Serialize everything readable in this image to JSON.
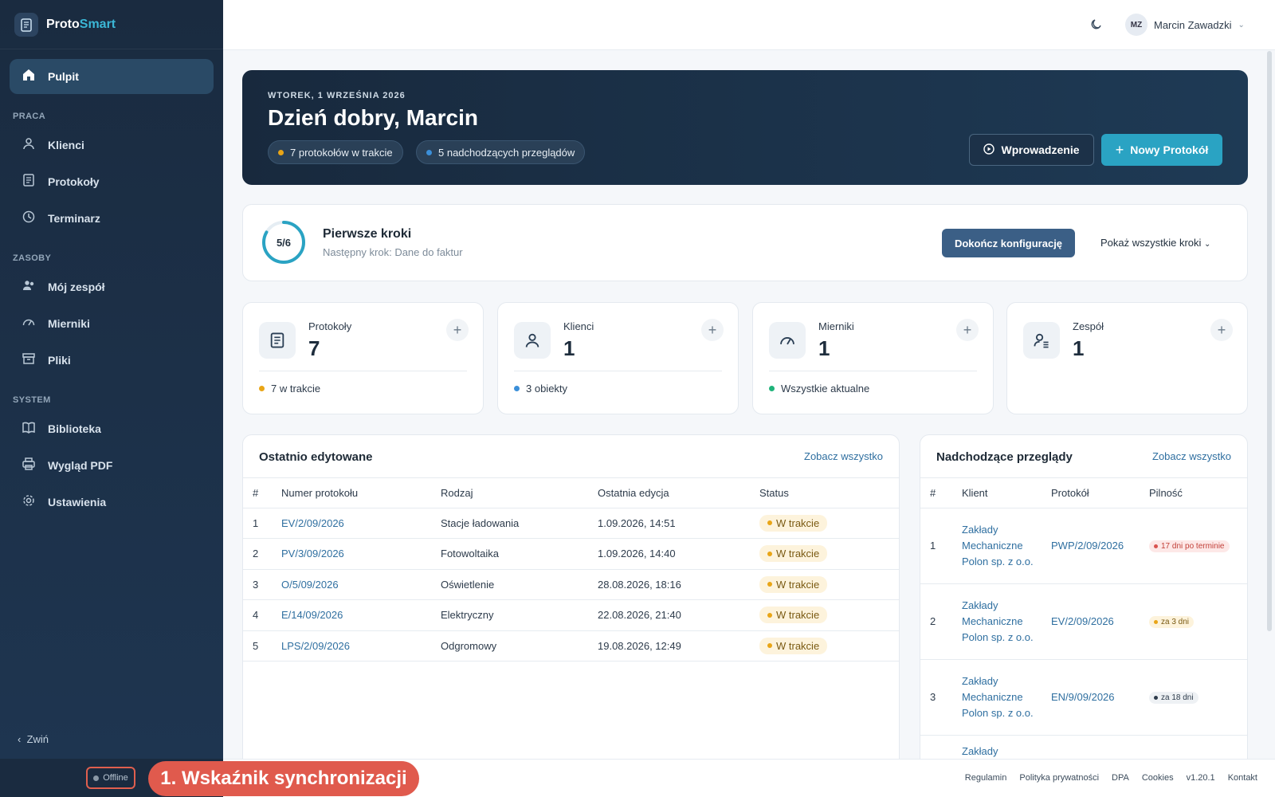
{
  "app": {
    "brand_part1": "Proto",
    "brand_part2": "Smart"
  },
  "colors": {
    "accent": "#2aa3c3",
    "sidebar": "#1a2b40",
    "warning": "#e9a516",
    "info": "#3b8fd9",
    "success": "#1fb37a",
    "danger": "#d9534f"
  },
  "sidebar": {
    "active": "Pulpit",
    "sections": {
      "praca": "PRACA",
      "zasoby": "ZASOBY",
      "system": "SYSTEM"
    },
    "items": [
      {
        "label": "Pulpit",
        "icon": "home-icon"
      },
      {
        "label": "Klienci",
        "icon": "user-icon"
      },
      {
        "label": "Protokoły",
        "icon": "document-icon"
      },
      {
        "label": "Terminarz",
        "icon": "clock-icon"
      },
      {
        "label": "Mój zespół",
        "icon": "team-icon"
      },
      {
        "label": "Mierniki",
        "icon": "gauge-icon"
      },
      {
        "label": "Pliki",
        "icon": "archive-icon"
      },
      {
        "label": "Biblioteka",
        "icon": "book-icon"
      },
      {
        "label": "Wygląd PDF",
        "icon": "printer-icon"
      },
      {
        "label": "Ustawienia",
        "icon": "gear-icon"
      }
    ],
    "collapse_label": "Zwiń"
  },
  "topbar": {
    "user_initials": "MZ",
    "user_name": "Marcin Zawadzki"
  },
  "hero": {
    "date": "WTOREK, 1 WRZEŚNIA 2026",
    "greeting": "Dzień dobry, Marcin",
    "chip_in_progress": "7 protokołów w trakcie",
    "chip_upcoming": "5 nadchodzących przeglądów",
    "intro_button": "Wprowadzenie",
    "new_button": "Nowy Protokół"
  },
  "steps": {
    "progress_label": "5/6",
    "progress_fraction": 0.8333,
    "title": "Pierwsze kroki",
    "subtitle": "Następny krok: Dane do faktur",
    "finish_button": "Dokończ konfigurację",
    "show_all": "Pokaż wszystkie kroki"
  },
  "stats": [
    {
      "label": "Protokoły",
      "value": "7",
      "foot": "7 w trakcie",
      "dot": "#e9a516",
      "icon": "document-icon"
    },
    {
      "label": "Klienci",
      "value": "1",
      "foot": "3 obiekty",
      "dot": "#3b8fd9",
      "icon": "user-icon"
    },
    {
      "label": "Mierniki",
      "value": "1",
      "foot": "Wszystkie aktualne",
      "dot": "#1fb37a",
      "icon": "gauge-icon"
    },
    {
      "label": "Zespół",
      "value": "1",
      "foot": "",
      "dot": "",
      "icon": "team-list-icon"
    }
  ],
  "recent": {
    "title": "Ostatnio edytowane",
    "see_all": "Zobacz wszystko",
    "columns": [
      "#",
      "Numer protokołu",
      "Rodzaj",
      "Ostatnia edycja",
      "Status"
    ],
    "rows": [
      {
        "n": "1",
        "number": "EV/2/09/2026",
        "kind": "Stacje ładowania",
        "edited": "1.09.2026, 14:51",
        "status": "W trakcie"
      },
      {
        "n": "2",
        "number": "PV/3/09/2026",
        "kind": "Fotowoltaika",
        "edited": "1.09.2026, 14:40",
        "status": "W trakcie"
      },
      {
        "n": "3",
        "number": "O/5/09/2026",
        "kind": "Oświetlenie",
        "edited": "28.08.2026, 18:16",
        "status": "W trakcie"
      },
      {
        "n": "4",
        "number": "E/14/09/2026",
        "kind": "Elektryczny",
        "edited": "22.08.2026, 21:40",
        "status": "W trakcie"
      },
      {
        "n": "5",
        "number": "LPS/2/09/2026",
        "kind": "Odgromowy",
        "edited": "19.08.2026, 12:49",
        "status": "W trakcie"
      }
    ]
  },
  "upcoming": {
    "title": "Nadchodzące przeglądy",
    "see_all": "Zobacz wszystko",
    "columns": [
      "#",
      "Klient",
      "Protokół",
      "Pilność"
    ],
    "rows": [
      {
        "n": "1",
        "client": "Zakłady Mechaniczne Polon sp. z o.o.",
        "protocol": "PWP/2/09/2026",
        "urgency": "17 dni po terminie",
        "tone": "danger"
      },
      {
        "n": "2",
        "client": "Zakłady Mechaniczne Polon sp. z o.o.",
        "protocol": "EV/2/09/2026",
        "urgency": "za 3 dni",
        "tone": "warning"
      },
      {
        "n": "3",
        "client": "Zakłady Mechaniczne Polon sp. z o.o.",
        "protocol": "EN/9/09/2026",
        "urgency": "za 18 dni",
        "tone": "neutral"
      },
      {
        "n": "",
        "client": "Zakłady",
        "protocol": "",
        "urgency": "",
        "tone": ""
      }
    ]
  },
  "footer": {
    "links": [
      "Regulamin",
      "Polityka prywatności",
      "DPA",
      "Cookies",
      "v1.20.1",
      "Kontakt"
    ],
    "sync_status": "Offline",
    "annotation": "1. Wskaźnik synchronizacji"
  }
}
